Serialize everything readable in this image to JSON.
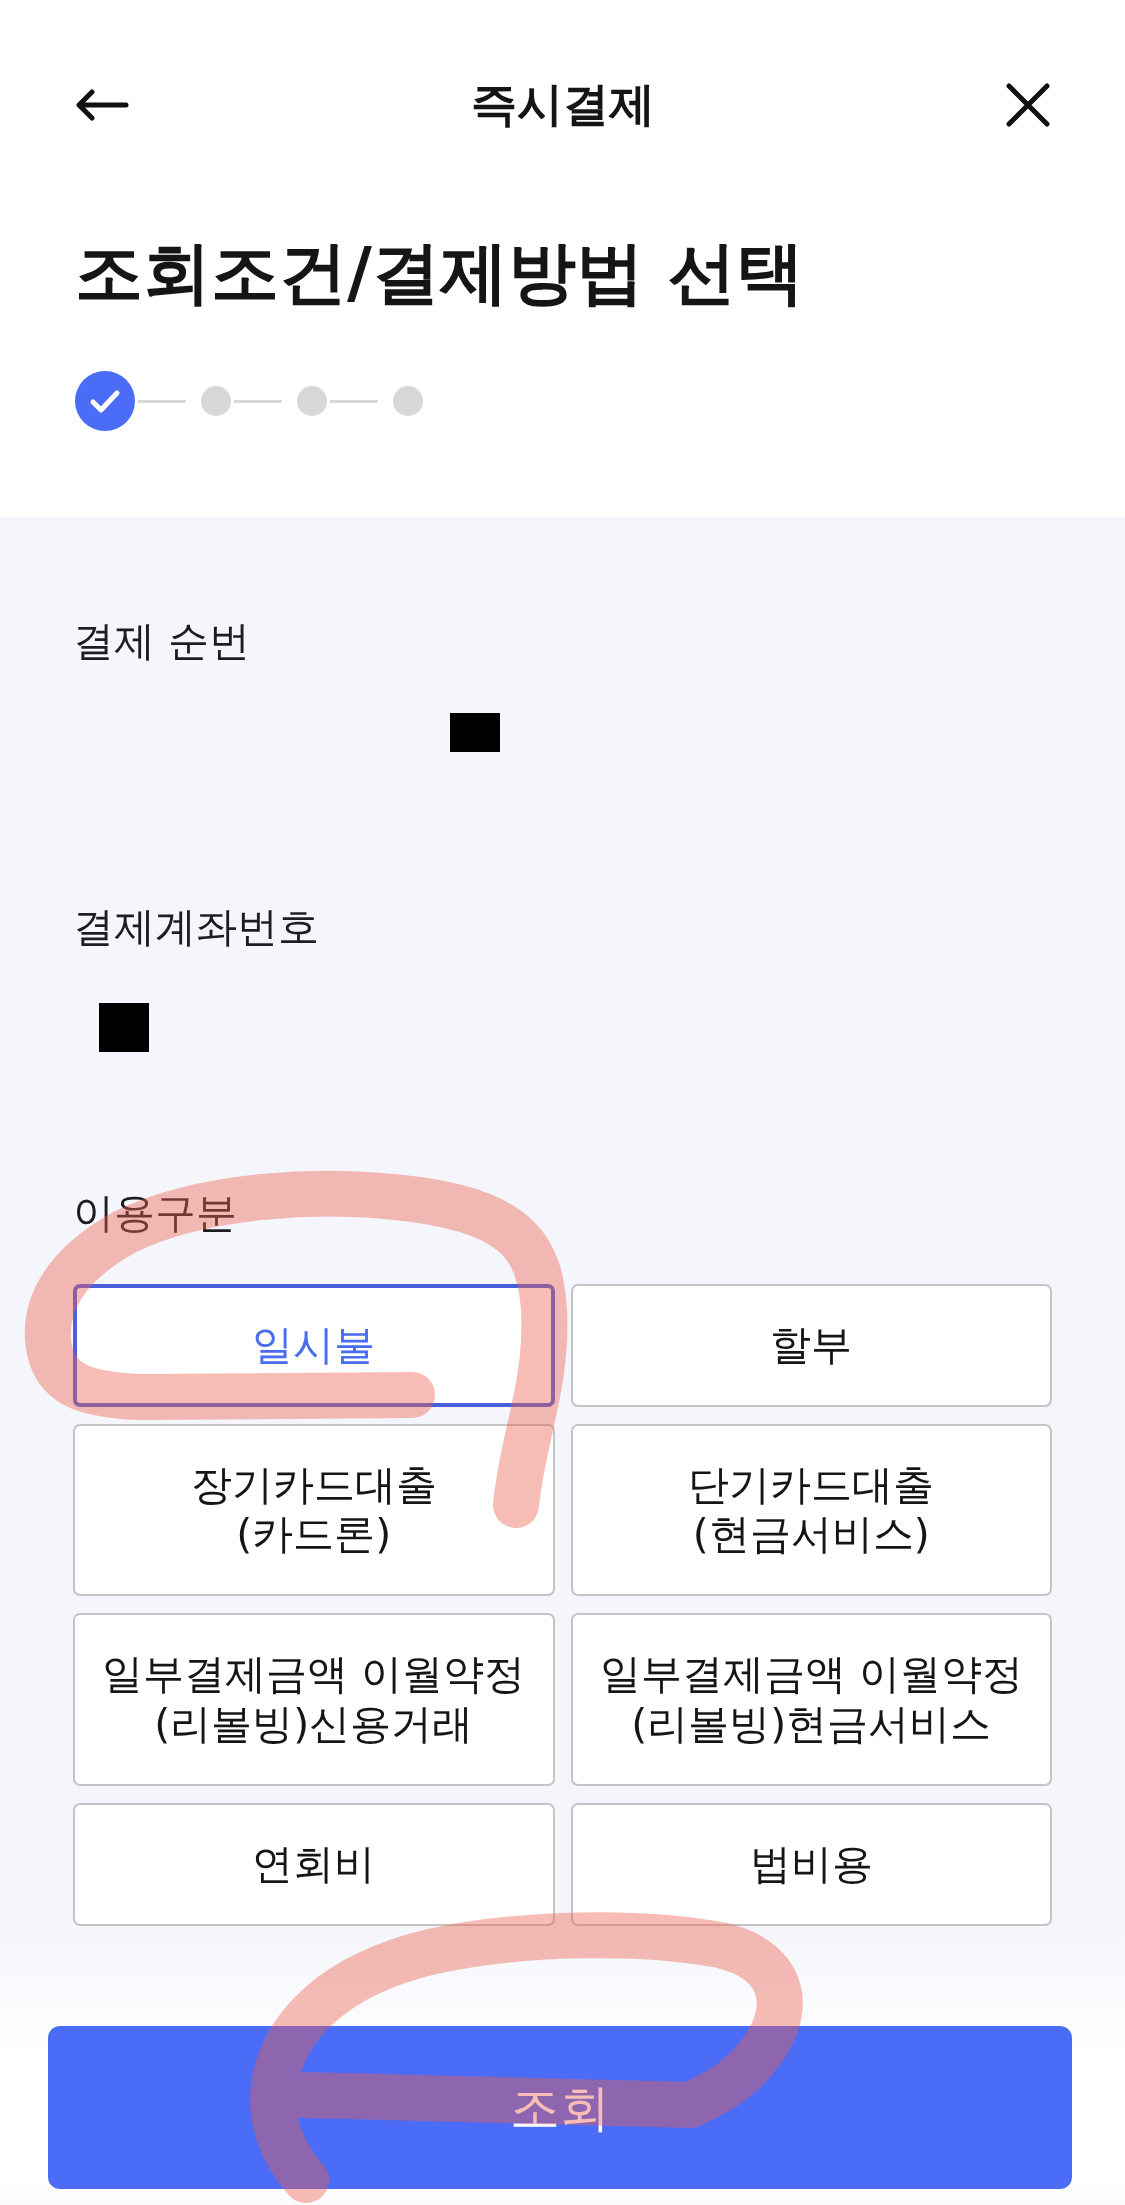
{
  "header": {
    "title": "즉시결제"
  },
  "page_title": "조회조건/결제방법 선택",
  "steps": [
    {
      "completed": true
    },
    {
      "completed": false
    },
    {
      "completed": false
    },
    {
      "completed": false
    }
  ],
  "fields": [
    {
      "label": "결제 순번",
      "redacted": true
    },
    {
      "label": "결제계좌번호",
      "redacted": true
    }
  ],
  "usage_type": {
    "label": "이용구분",
    "options": [
      {
        "label": "일시불",
        "selected": true
      },
      {
        "label": "할부",
        "selected": false
      },
      {
        "label": "장기카드대출\n(카드론)",
        "selected": false
      },
      {
        "label": "단기카드대출\n(현금서비스)",
        "selected": false
      },
      {
        "label": "일부결제금액 이월약정\n(리볼빙)신용거래",
        "selected": false
      },
      {
        "label": "일부결제금액 이월약정\n(리볼빙)현금서비스",
        "selected": false
      },
      {
        "label": "연회비",
        "selected": false
      },
      {
        "label": "법비용",
        "selected": false
      }
    ]
  },
  "submit_button": {
    "label": "조회"
  }
}
